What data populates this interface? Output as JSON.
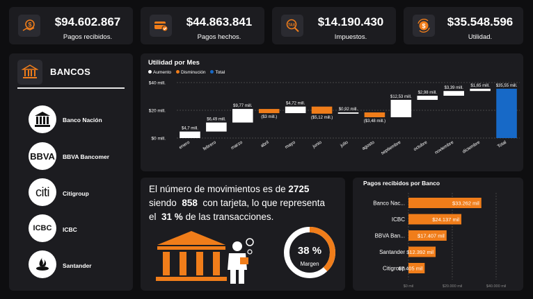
{
  "kpis": [
    {
      "value": "$94.602.867",
      "label": "Pagos recibidos.",
      "icon": "hand-money-icon"
    },
    {
      "value": "$44.863.841",
      "label": "Pagos hechos.",
      "icon": "card-check-icon"
    },
    {
      "value": "$14.190.430",
      "label": "Impuestos.",
      "icon": "tax-search-icon"
    },
    {
      "value": "$35.548.596",
      "label": "Utilidad.",
      "icon": "dollar-cycle-icon"
    }
  ],
  "banks_panel": {
    "title": "BANCOS",
    "items": [
      {
        "name": "Banco Nación",
        "logo": "bank-building"
      },
      {
        "name": "BBVA Bancomer",
        "logo": "BBVA"
      },
      {
        "name": "Citigroup",
        "logo": "citi"
      },
      {
        "name": "ICBC",
        "logo": "ICBC"
      },
      {
        "name": "Santander",
        "logo": "flame"
      }
    ]
  },
  "summary": {
    "line1_pre": "El número de movimientos es de",
    "movements": "2725",
    "line2_pre": "siendo",
    "with_card": "858",
    "line2_post": "con tarjeta, lo que representa",
    "line3_pre": "el",
    "percent": "31 %",
    "line3_post": "de las transacciones.",
    "donut_value": "38 %",
    "donut_label": "Margen",
    "donut_fraction": 0.38
  },
  "colors": {
    "increase": "#ffffff",
    "decrease": "#f07d1a",
    "total": "#1769c7",
    "accent": "#f07d1a"
  },
  "chart_data": [
    {
      "type": "bar",
      "subtype": "waterfall",
      "title": "Utilidad por Mes",
      "legend": [
        "Aumento",
        "Disminución",
        "Total"
      ],
      "legend_position": "top-left",
      "categories": [
        "enero",
        "febrero",
        "marzo",
        "abril",
        "mayo",
        "junio",
        "julio",
        "agosto",
        "septiembre",
        "octubre",
        "noviembre",
        "diciembre",
        "Total"
      ],
      "values": [
        4.7,
        6.49,
        9.77,
        -3,
        4.72,
        -5.12,
        0.92,
        -3.48,
        12.53,
        2.98,
        3.39,
        1.65,
        35.55
      ],
      "kinds": [
        "Aumento",
        "Aumento",
        "Aumento",
        "Disminución",
        "Aumento",
        "Disminución",
        "Aumento",
        "Disminución",
        "Aumento",
        "Aumento",
        "Aumento",
        "Aumento",
        "Total"
      ],
      "data_labels": [
        "$4,7 mill.",
        "$6,49 mill.",
        "$9,77 mill.",
        "($3 mill.)",
        "$4,72 mill.",
        "($5,12 mill.)",
        "$0,92 mill.",
        "($3,48 mill.)",
        "$12,53 mill.",
        "$2,98 mill.",
        "$3,39 mill.",
        "$1,65 mill.",
        "$35,55 mill."
      ],
      "yticks": [
        "$0 mill.",
        "$20 mill.",
        "$40 mill."
      ],
      "ylim": [
        0,
        40
      ],
      "grid": true
    },
    {
      "type": "bar",
      "orientation": "horizontal",
      "title": "Pagos recibidos por Banco",
      "categories": [
        "Banco Nac...",
        "ICBC",
        "BBVA Ban...",
        "Santander",
        "Citigroup"
      ],
      "values": [
        33262,
        24137,
        17407,
        12392,
        7405
      ],
      "data_labels": [
        "$33.262 mil",
        "$24.137 mil",
        "$17.407 mil",
        "$12.392 mil",
        "$7.405 mil"
      ],
      "xticks": [
        "$0 mil",
        "$20.000 mil",
        "$40.000 mil"
      ],
      "xlim": [
        0,
        40000
      ],
      "grid": true
    }
  ]
}
